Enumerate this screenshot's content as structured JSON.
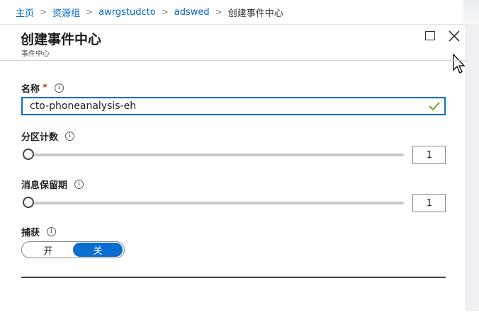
{
  "breadcrumb": {
    "items": [
      "主页",
      "资源组",
      "awrgstudcto",
      "adswed"
    ],
    "current": "创建事件中心"
  },
  "blade": {
    "title": "创建事件中心",
    "subtitle": "事件中心",
    "maximize_icon": "maximize-icon",
    "close_icon": "close-icon"
  },
  "form": {
    "name": {
      "label": "名称",
      "required_marker": "*",
      "info_icon": "i",
      "value": "cto-phoneanalysis-eh",
      "valid_icon": "checkmark-icon"
    },
    "partition_count": {
      "label": "分区计数",
      "info_icon": "i",
      "value": "1",
      "slider_fraction": 0
    },
    "retention": {
      "label": "消息保留期",
      "info_icon": "i",
      "value": "1",
      "slider_fraction": 0
    },
    "capture": {
      "label": "捕获",
      "info_icon": "i",
      "on_label": "开",
      "off_label": "关",
      "selected": "off"
    }
  },
  "colors": {
    "accent": "#0a6ed1",
    "link": "#0066c0",
    "required": "#c0392b"
  }
}
